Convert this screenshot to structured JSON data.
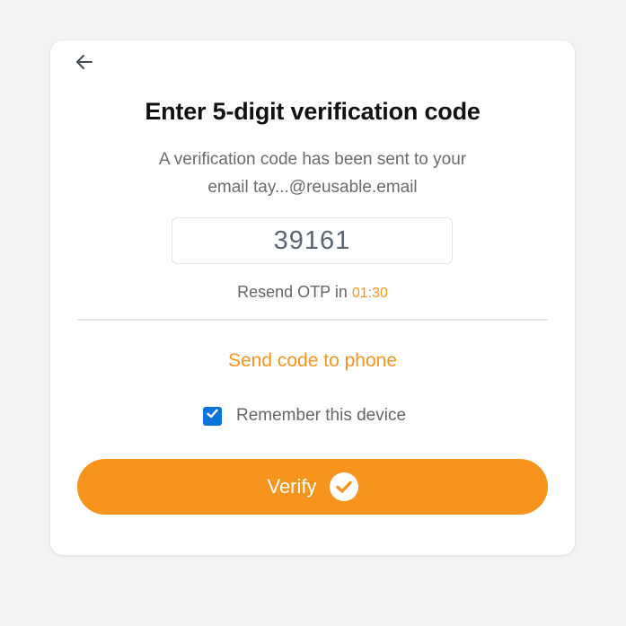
{
  "header": {
    "back_icon": "arrow-left-icon",
    "title": "Enter 5-digit verification code"
  },
  "message": {
    "line1": "A verification code has been sent to your",
    "line2": "email tay...@reusable.email"
  },
  "otp": {
    "value": "39161"
  },
  "resend": {
    "label": "Resend OTP in",
    "timer": "01:30"
  },
  "alternate": {
    "send_to_phone_label": "Send code to phone"
  },
  "remember": {
    "label": "Remember this device",
    "checked": true
  },
  "actions": {
    "verify_label": "Verify",
    "verify_icon": "check-circle-icon"
  },
  "colors": {
    "accent": "#f7941d",
    "checkbox": "#0a74da",
    "background": "#f3f4f6",
    "card": "#ffffff"
  }
}
